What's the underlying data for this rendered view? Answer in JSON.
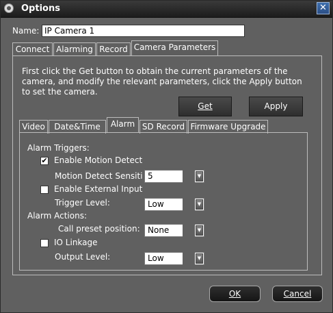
{
  "window": {
    "title": "Options"
  },
  "name": {
    "label": "Name:",
    "value": "IP Camera 1"
  },
  "main_tabs": [
    "Connect",
    "Alarming",
    "Record",
    "Camera Parameters"
  ],
  "camera_params": {
    "instructions": "First click the Get button to obtain the current parameters of the camera, and modify the relevant parameters, click the Apply button to set the camera.",
    "get_label": "Get",
    "apply_label": "Apply"
  },
  "sub_tabs": [
    "Video",
    "Date&Time",
    "Alarm",
    "SD Record",
    "Firmware Upgrade"
  ],
  "alarm": {
    "triggers_header": "Alarm Triggers:",
    "enable_motion_label": "Enable Motion Detect",
    "enable_motion_checked": true,
    "sensitivity_label": "Motion Detect Sensitivi",
    "sensitivity_value": "5",
    "enable_external_label": "Enable External Input",
    "enable_external_checked": false,
    "trigger_level_label": "Trigger Level:",
    "trigger_level_value": "Low",
    "actions_header": "Alarm Actions:",
    "preset_label": "Call preset position:",
    "preset_value": "None",
    "io_linkage_label": "IO Linkage",
    "io_linkage_checked": false,
    "output_level_label": "Output Level:",
    "output_level_value": "Low"
  },
  "footer": {
    "ok_label": "OK",
    "cancel_label": "Cancel"
  }
}
